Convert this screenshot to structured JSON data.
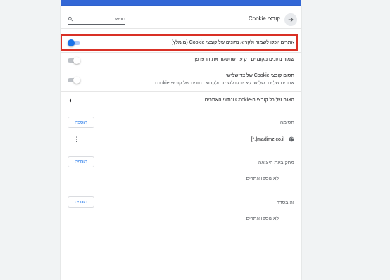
{
  "header": {
    "title": "קובצי Cookie",
    "search_placeholder": "חפש"
  },
  "settings": [
    {
      "label": "אתרים יוכלו לשמור ולקרוא נתונים של קובצי Cookie (מומלץ)",
      "on": true
    },
    {
      "label": "שמור נתונים מקומיים רק עד שתסגור את הדפדפן",
      "on": false
    },
    {
      "label": "חסום קובצי Cookie של צד שלישי",
      "sub": "אתרים של צד שלישי לא יוכלו לשמור ולקרוא נתונים של קובצי cookie",
      "on": false
    }
  ],
  "all_cookies_link": "הצגה של כל קובצי ה-Cookie ונתוני האתרים",
  "sections": {
    "block": {
      "title": "חסימה",
      "add_label": "הוספה",
      "sites": [
        "[*.]madimz.co.il"
      ]
    },
    "clear_on_exit": {
      "title": "מחק בעת היציאה",
      "add_label": "הוספה",
      "empty": "לא נוספו אתרים"
    },
    "allow": {
      "title": "זה בסדר",
      "add_label": "הוספה",
      "empty": "לא נוספו אתרים"
    }
  },
  "colors": {
    "accent": "#1a73e8",
    "highlight_border": "#d93025",
    "top_bar": "#3367d6"
  }
}
